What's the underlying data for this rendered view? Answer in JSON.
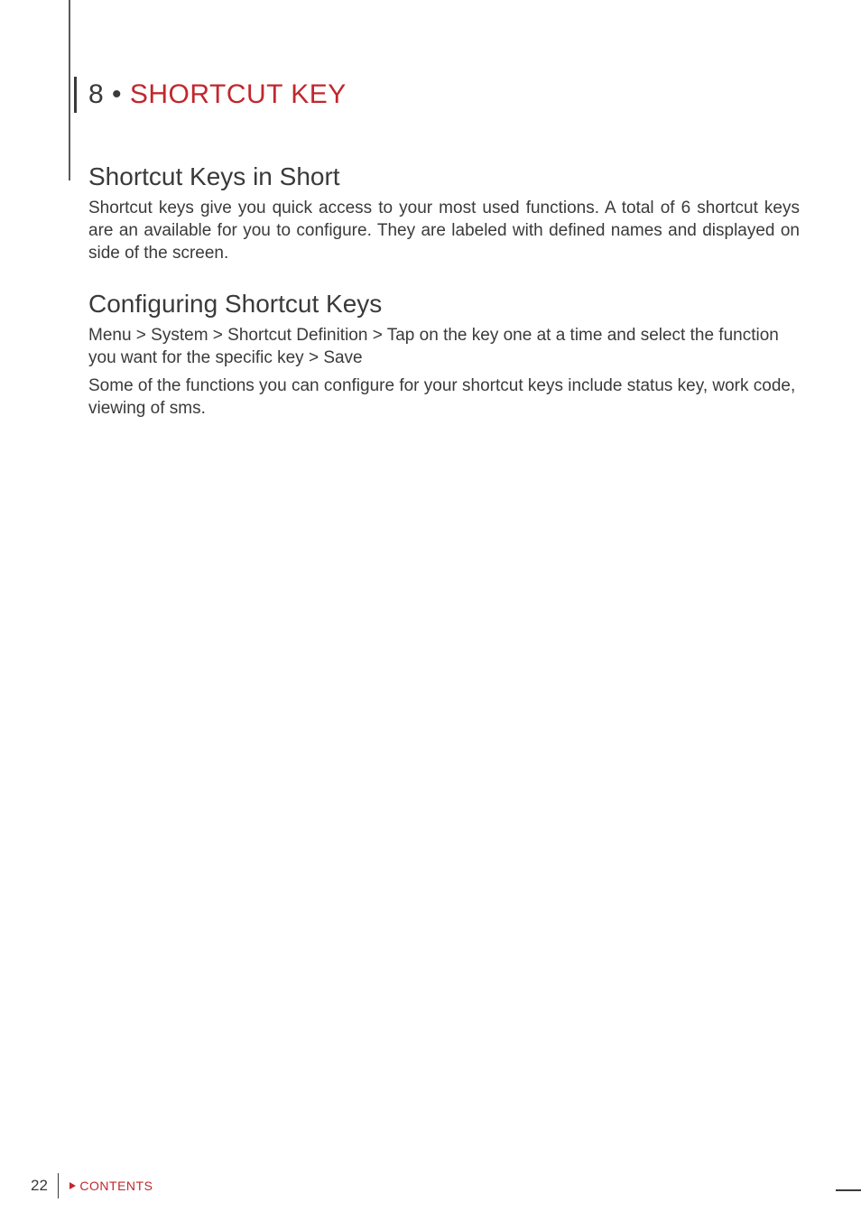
{
  "chapter": {
    "number": "8",
    "separator": " • ",
    "title": "SHORTCUT KEY"
  },
  "sections": [
    {
      "heading": "Shortcut Keys in Short",
      "paragraphs": [
        "Shortcut keys give you quick access to your most used functions. A total of 6 shortcut keys are an available for you to configure. They are labeled with defined names and displayed on side of the screen."
      ],
      "justify": true
    },
    {
      "heading": "Configuring Shortcut Keys",
      "paragraphs": [
        "Menu > System > Shortcut Definition > Tap on the key one at a time and select the function you want for the specific key > Save",
        "Some of the functions you can configure for your shortcut keys include status key, work code, viewing of sms."
      ],
      "justify": false
    }
  ],
  "footer": {
    "pageNumber": "22",
    "contentsLabel": "CONTENTS"
  }
}
